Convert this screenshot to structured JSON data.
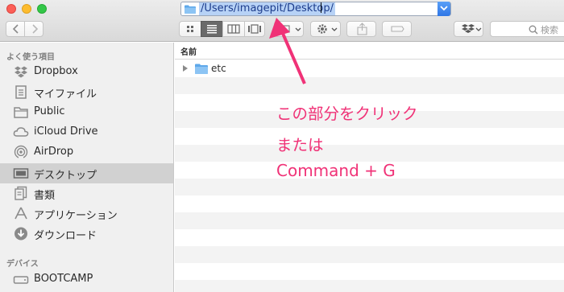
{
  "window": {
    "path": "/Users/imagepit/Desktop/"
  },
  "toolbar": {
    "search_placeholder": "検索"
  },
  "sidebar": {
    "favorites_header": "よく使う項目",
    "devices_header": "デバイス",
    "items": [
      {
        "label": "Dropbox",
        "icon": "dropbox-icon"
      },
      {
        "label": "マイファイル",
        "icon": "all-my-files-icon"
      },
      {
        "label": "Public",
        "icon": "folder-icon"
      },
      {
        "label": "iCloud Drive",
        "icon": "cloud-icon"
      },
      {
        "label": "AirDrop",
        "icon": "airdrop-icon"
      },
      {
        "label": "デスクトップ",
        "icon": "desktop-icon",
        "selected": true
      },
      {
        "label": "書類",
        "icon": "documents-icon"
      },
      {
        "label": "アプリケーション",
        "icon": "applications-icon"
      },
      {
        "label": "ダウンロード",
        "icon": "downloads-icon"
      }
    ],
    "devices": [
      {
        "label": "BOOTCAMP",
        "icon": "drive-icon"
      }
    ]
  },
  "list": {
    "column_name": "名前",
    "files": [
      {
        "name": "etc",
        "type": "folder"
      }
    ]
  },
  "annotation": {
    "line1": "この部分をクリック",
    "line2": "または",
    "line3": "Command + G",
    "color": "#f03277"
  }
}
